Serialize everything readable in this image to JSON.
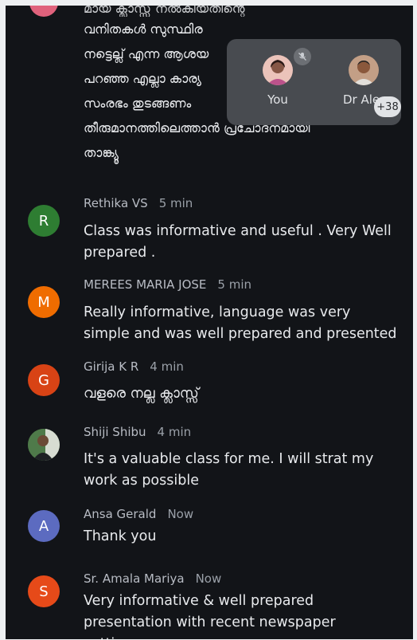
{
  "partial_message": {
    "lines": [
      "മായ ക്ലാസ്സ് നൽകിയതിന്റെ",
      "വനിതകൾ സുസ്ഥിര",
      "നട്ടെല്ല് എന്ന ആശയ",
      "പറഞ്ഞ എല്ലാ കാര്യ",
      "സംരഭം തുടങ്ങണം",
      "തീരുമാനത്തിലെത്താൻ പ്രചോദനമായി",
      "താങ്ക്യൂ"
    ]
  },
  "participants_overlay": {
    "tiles": [
      {
        "name": "You"
      },
      {
        "name": "Dr Ale"
      }
    ],
    "more_count": "+38"
  },
  "messages": [
    {
      "initial": "R",
      "color": "#2e7d32",
      "author": "Rethika VS",
      "time": "5 min",
      "text": "Class was informative and useful . Very Well prepared ."
    },
    {
      "initial": "M",
      "color": "#ef6c00",
      "author": "MEREES MARIA JOSE",
      "time": "5 min",
      "text": "Really informative, language was very simple and was well prepared and presented"
    },
    {
      "initial": "G",
      "color": "#d84315",
      "author": "Girija K R",
      "time": "4 min",
      "text": "വളരെ നല്ല ക്ലാസ്സ്"
    },
    {
      "initial": "",
      "color": "#3a5b3a",
      "author": "Shiji Shibu",
      "time": "4 min",
      "text": "It's a valuable class for me. I will strat my work as possible"
    },
    {
      "initial": "A",
      "color": "#5c6bc0",
      "author": "Ansa Gerald",
      "time": "Now",
      "text": "Thank you"
    },
    {
      "initial": "S",
      "color": "#e64a19",
      "author": "Sr. Amala Mariya",
      "time": "Now",
      "text": "Very informative & well prepared presentation with recent newspaper cuttings."
    }
  ]
}
